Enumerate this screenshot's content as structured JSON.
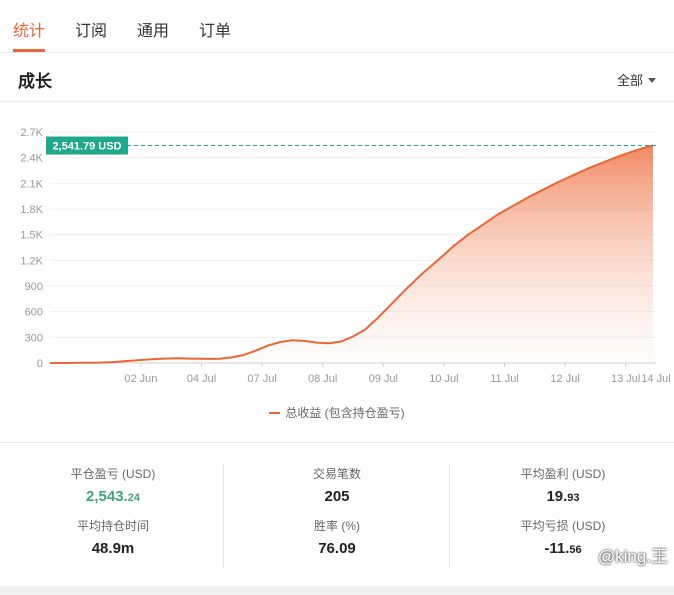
{
  "tabs": [
    {
      "label": "统计",
      "active": true
    },
    {
      "label": "订阅",
      "active": false
    },
    {
      "label": "通用",
      "active": false
    },
    {
      "label": "订单",
      "active": false
    }
  ],
  "section": {
    "title": "成长",
    "filter": "全部"
  },
  "accent_color": "#e8673a",
  "highlight_color": "#1fa88a",
  "chart_data": {
    "type": "area",
    "y_ticks": [
      "0",
      "300",
      "600",
      "900",
      "1.2K",
      "1.5K",
      "1.8K",
      "2.1K",
      "2.4K",
      "2.7K"
    ],
    "ylim": [
      0,
      2700
    ],
    "x_ticks": [
      "02 Jun",
      "04 Jul",
      "07 Jul",
      "08 Jul",
      "09 Jul",
      "10 Jul",
      "11 Jul",
      "12 Jul",
      "13 Jul",
      "14 Jul"
    ],
    "series": [
      {
        "name": "总收益 (包含持仓盈亏)",
        "color": "#e8673a",
        "x": [
          0,
          0.5,
          1,
          1.5,
          2,
          2.5,
          3,
          3.4,
          3.8,
          4.2,
          4.6,
          5.0,
          5.3,
          5.6,
          6.0,
          6.4,
          6.8,
          7.2,
          7.6,
          8.0,
          8.4,
          8.8,
          9.2,
          9.6,
          10.0,
          10.4,
          10.8,
          11.3,
          11.8,
          12.3,
          12.8,
          13.3,
          13.8,
          14.3,
          14.8,
          15.3,
          15.8,
          16.3,
          16.8,
          17.3,
          17.8,
          18.3,
          18.8,
          19.3,
          19.6,
          19.9
        ],
        "y": [
          0,
          0,
          2,
          4,
          8,
          22,
          35,
          45,
          52,
          55,
          52,
          50,
          48,
          50,
          65,
          95,
          145,
          205,
          245,
          265,
          258,
          238,
          230,
          250,
          310,
          390,
          520,
          700,
          880,
          1050,
          1200,
          1360,
          1500,
          1620,
          1740,
          1840,
          1940,
          2030,
          2120,
          2200,
          2280,
          2350,
          2420,
          2480,
          2515,
          2541.79
        ]
      }
    ],
    "current_value_label": "2,541.79 USD",
    "current_value": 2541.79
  },
  "stats": [
    {
      "label": "平仓盈亏 (USD)",
      "value_main": "2,543.",
      "value_small": "24",
      "color": "green"
    },
    {
      "label": "交易笔数",
      "value_main": "205",
      "value_small": ""
    },
    {
      "label": "平均盈利 (USD)",
      "value_main": "19.",
      "value_small": "93"
    },
    {
      "label": "平均持仓时间",
      "value_main": "48.9m",
      "value_small": ""
    },
    {
      "label": "胜率 (%)",
      "value_main": "76.09",
      "value_small": ""
    },
    {
      "label": "平均亏损 (USD)",
      "value_main": "-11.",
      "value_small": "56"
    }
  ],
  "watermark": "@king.王"
}
